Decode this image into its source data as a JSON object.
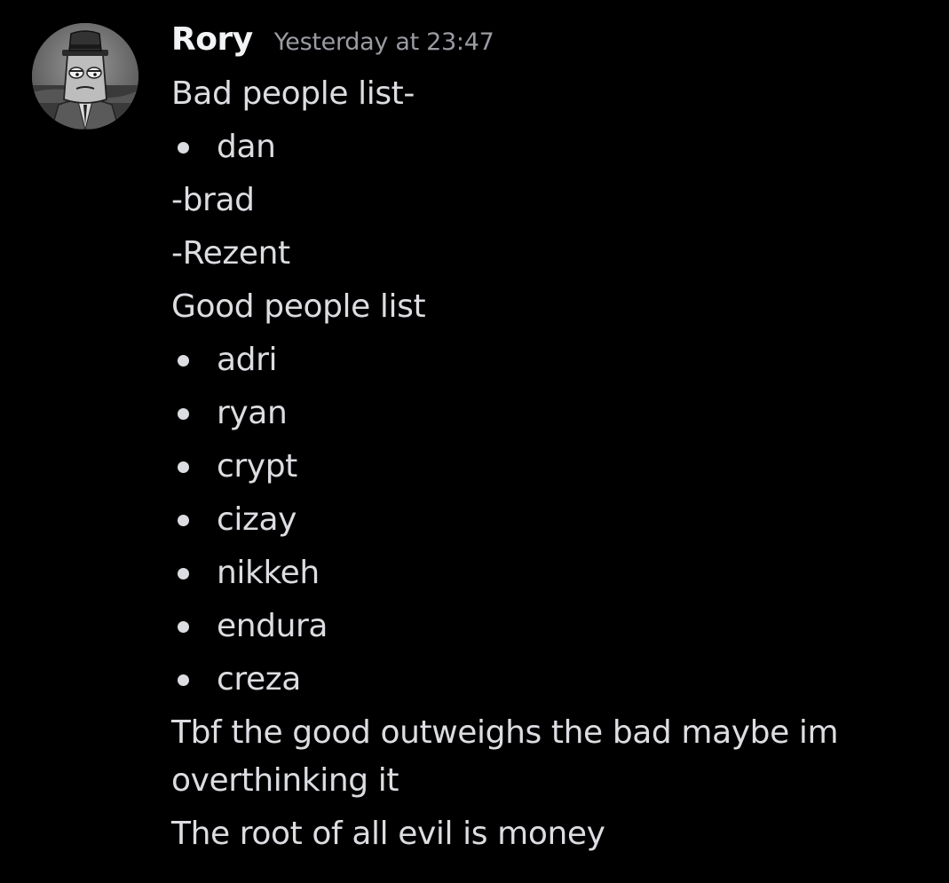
{
  "message": {
    "author": "Rory",
    "timestamp": "Yesterday at 23:47",
    "lines": {
      "bad_heading": "Bad people list-",
      "bad_bullet_1": "dan",
      "bad_dash_1": "-brad",
      "bad_dash_2": "-Rezent",
      "good_heading": "Good people list",
      "good_bullets": [
        "adri",
        "ryan",
        "crypt",
        "cizay",
        "nikkeh",
        "endura",
        "creza"
      ],
      "comment": "Tbf the good outweighs the bad maybe im overthinking it",
      "closing": "The root of all evil is money"
    }
  },
  "avatar": {
    "icon": "cartoon-character-avatar"
  },
  "colors": {
    "background": "#000000",
    "author": "#f2f3f5",
    "timestamp": "#9a9ca2",
    "text": "#dcdde1"
  }
}
